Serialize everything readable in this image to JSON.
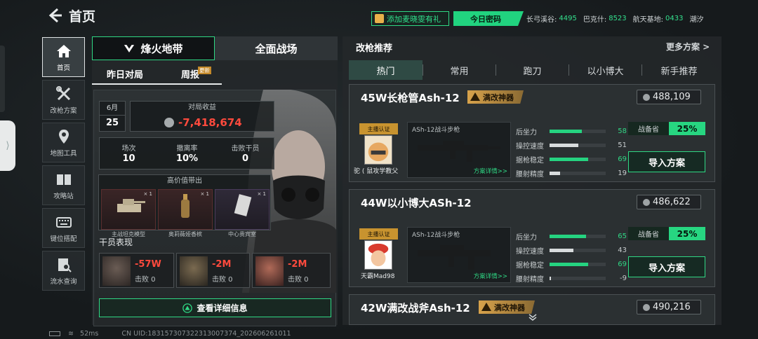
{
  "header": {
    "title": "首页",
    "gift_button": "添加麦晓雯有礼",
    "password_button": "今日密码",
    "codes": [
      {
        "label": "长弓溪谷:",
        "value": "4495"
      },
      {
        "label": "巴克什:",
        "value": "8523"
      },
      {
        "label": "航天基地:",
        "value": "0433"
      },
      {
        "label": "潮汐",
        "value": ""
      }
    ]
  },
  "nav": [
    {
      "label": "首页",
      "icon": "home-icon"
    },
    {
      "label": "改枪方案",
      "icon": "tools-icon"
    },
    {
      "label": "地图工具",
      "icon": "map-pin-icon"
    },
    {
      "label": "攻略站",
      "icon": "book-icon"
    },
    {
      "label": "键位搭配",
      "icon": "keyboard-icon"
    },
    {
      "label": "流水查询",
      "icon": "ledger-search-icon"
    }
  ],
  "left": {
    "tabs": [
      "烽火地带",
      "全面战场"
    ],
    "subtabs": [
      "昨日对局",
      "周报"
    ],
    "new_badge": "更新",
    "month": "6月",
    "day": "25",
    "income_label": "对局收益",
    "income_value": "-7,418,674",
    "stats": [
      {
        "label": "场次",
        "value": "10"
      },
      {
        "label": "撤离率",
        "value": "10%"
      },
      {
        "label": "击败干员",
        "value": "0"
      }
    ],
    "valuable_title": "高价值带出",
    "valuables": [
      {
        "name": "主战坦克模型",
        "count": "× 1"
      },
      {
        "name": "奥莉薇娅香槟",
        "count": "× 1"
      },
      {
        "name": "中心贵宾室",
        "count": "× 1"
      }
    ],
    "members_title": "干员表现",
    "members": [
      {
        "value": "-57W",
        "kills": "击败 0"
      },
      {
        "value": "-2M",
        "kills": "击败 0"
      },
      {
        "value": "-2M",
        "kills": "击败 0"
      }
    ],
    "detail_button": "查看详细信息"
  },
  "right": {
    "title": "改枪推荐",
    "more": "更多方案 >",
    "filters": [
      "热门",
      "常用",
      "跑刀",
      "以小博大",
      "新手推荐"
    ],
    "loadouts": [
      {
        "title": "45W长枪管Ash-12",
        "tag": "满改神器",
        "price": "488,109",
        "anchor_badge": "主播认证",
        "anchor_name": "驼 ( 鼠攻学教父",
        "weapon": "ASh-12战斗步枪",
        "detail": "方案详情>>",
        "stats": [
          {
            "label": "后坐力",
            "value": "58",
            "pct": 58
          },
          {
            "label": "操控速度",
            "value": "51",
            "pct": 51
          },
          {
            "label": "据枪稳定",
            "value": "69",
            "pct": 69
          },
          {
            "label": "腰射精度",
            "value": "19",
            "pct": 19
          }
        ],
        "prep_label": "战备省",
        "prep_value": "25%",
        "import": "导入方案"
      },
      {
        "title": "44W以小博大ASh-12",
        "tag": "",
        "price": "486,622",
        "anchor_badge": "主播认证",
        "anchor_name": "天霸Mad98",
        "weapon": "ASh-12战斗步枪",
        "detail": "方案详情>>",
        "stats": [
          {
            "label": "后坐力",
            "value": "65",
            "pct": 65
          },
          {
            "label": "操控速度",
            "value": "43",
            "pct": 43
          },
          {
            "label": "据枪稳定",
            "value": "69",
            "pct": 69
          },
          {
            "label": "腰射精度",
            "value": "-9",
            "pct": 3
          }
        ],
        "prep_label": "战备省",
        "prep_value": "25%",
        "import": "导入方案"
      },
      {
        "title": "42W满改战斧Ash-12",
        "tag": "满改神器",
        "price": "490,216"
      }
    ]
  },
  "status": {
    "ping": "52ms",
    "uid": "CN UID:18315730732231300737‪4_202606261011"
  }
}
